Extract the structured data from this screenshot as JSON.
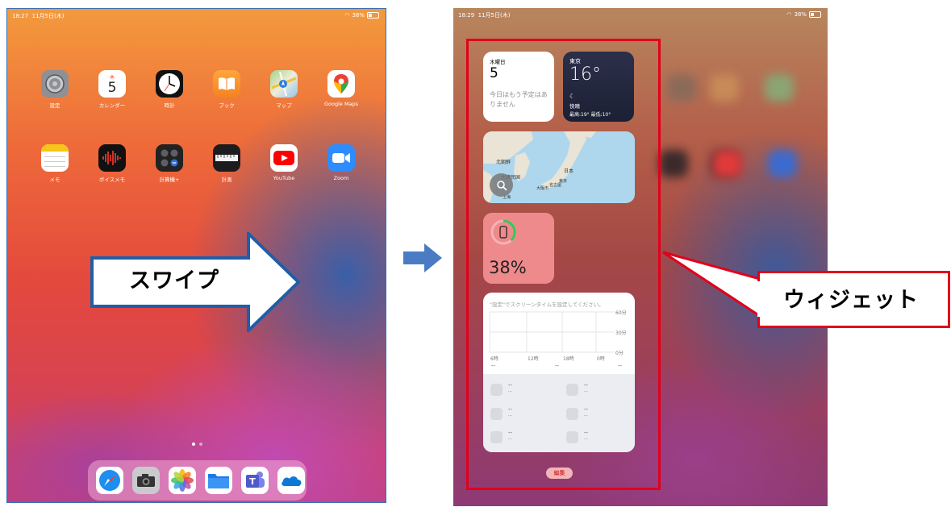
{
  "left_screen": {
    "status_time": "18:27",
    "status_date": "11月5日(木)",
    "status_battery": "38%",
    "apps_row1": [
      "設定",
      "カレンダー",
      "時計",
      "ブック",
      "マップ",
      "Google Maps"
    ],
    "apps_row2": [
      "メモ",
      "ボイスメモ",
      "計算機+",
      "計測",
      "YouTube",
      "Zoom"
    ],
    "calendar_day": "木",
    "calendar_num": "5",
    "dock_icons": [
      "safari-icon",
      "camera-icon",
      "photos-icon",
      "files-icon",
      "teams-icon",
      "onedrive-icon"
    ]
  },
  "swipe_label": "スワイプ",
  "right_screen": {
    "status_time": "18:29",
    "status_date": "11月5日(木)",
    "status_battery": "38%",
    "calendar_widget": {
      "weekday": "木曜日",
      "day": "5",
      "message": "今日はもう予定はありません"
    },
    "weather_widget": {
      "city": "東京",
      "temp": "16°",
      "condition": "快晴",
      "high_low": "最高:19° 最低:10°"
    },
    "map_widget": {
      "labels": [
        "北朝鮮",
        "日本",
        "大韓民国",
        "大阪市",
        "名古屋",
        "東京",
        "上海"
      ]
    },
    "battery_widget": {
      "percent": "38%"
    },
    "screen_time_widget": {
      "hint": "\"設定\"でスクリーンタイムを設定してください。",
      "y_ticks": [
        "60分",
        "30分",
        "0分"
      ],
      "x_ticks": [
        "6時",
        "12時",
        "18時",
        "0時"
      ],
      "dash": "--",
      "sub_dash": "..."
    },
    "edit_button": "編集"
  },
  "callout_label": "ウィジェット",
  "colors": {
    "frame_red": "#e2001a",
    "arrow_blue": "#4a7cc4"
  }
}
